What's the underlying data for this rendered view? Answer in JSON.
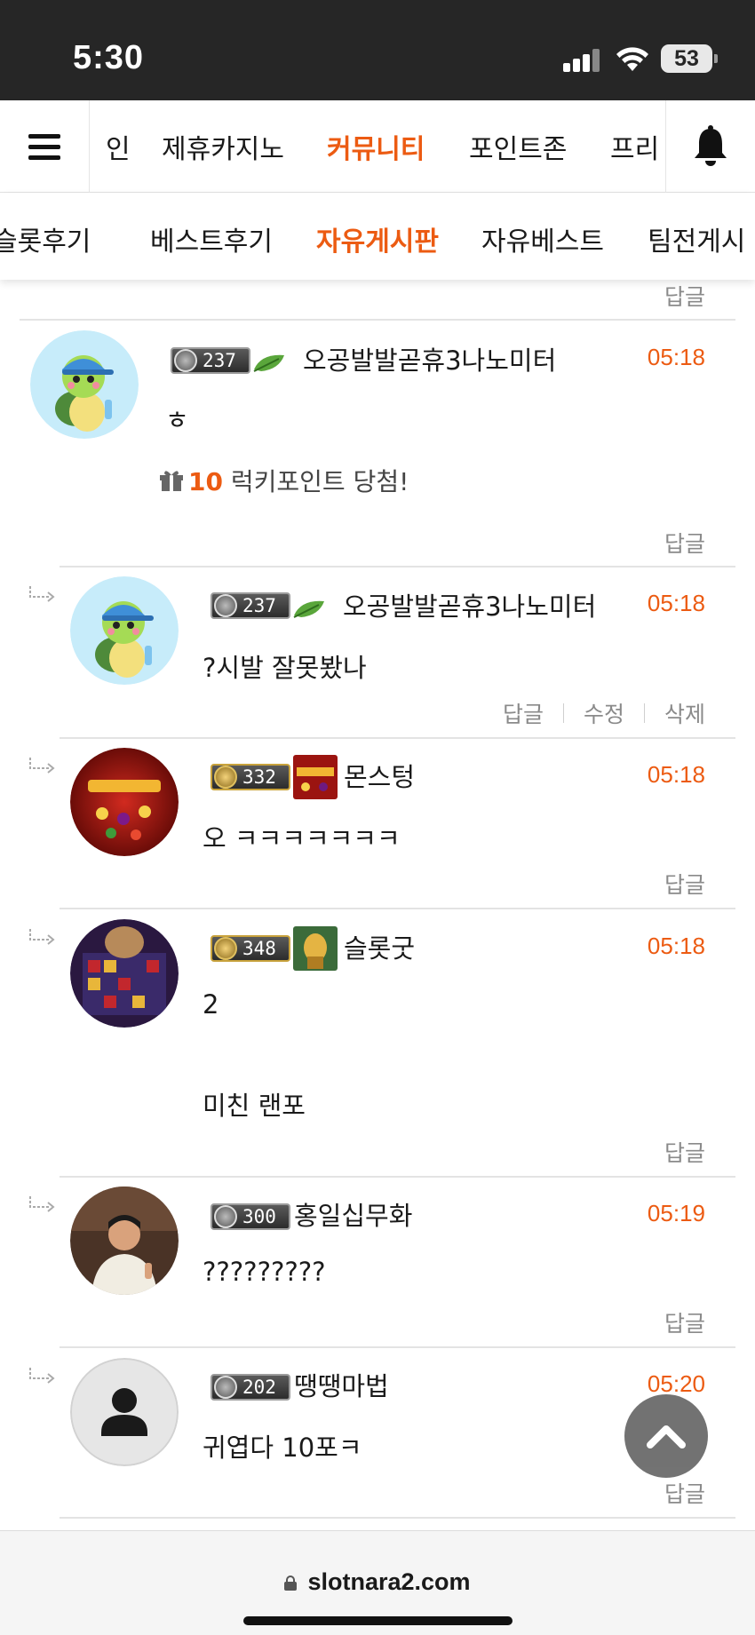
{
  "status": {
    "time": "5:30",
    "battery": "53"
  },
  "main_nav": {
    "items": [
      {
        "label": "인"
      },
      {
        "label": "제휴카지노"
      },
      {
        "label": "커뮤니티"
      },
      {
        "label": "포인트존"
      },
      {
        "label": "프리"
      }
    ],
    "active_color": "#ec5b12"
  },
  "sub_nav": {
    "items": [
      {
        "label": "슬롯후기"
      },
      {
        "label": "베스트후기"
      },
      {
        "label": "자유게시판"
      },
      {
        "label": "자유베스트"
      },
      {
        "label": "팀전게시"
      }
    ]
  },
  "top_reply_label": "답글",
  "comments": [
    {
      "level": "237",
      "username": "오공발발곧휴3나노미터",
      "time": "05:18",
      "text": "ㅎ",
      "lucky_points": "10",
      "lucky_text": "럭키포인트 당첨!",
      "reply_label": "답글"
    },
    {
      "level": "237",
      "username": "오공발발곧휴3나노미터",
      "time": "05:18",
      "text": "?시발 잘못봤나",
      "reply_label": "답글",
      "edit_label": "수정",
      "delete_label": "삭제"
    },
    {
      "level": "332",
      "username": "몬스텅",
      "time": "05:18",
      "text": "오 ㅋㅋㅋㅋㅋㅋㅋ",
      "reply_label": "답글"
    },
    {
      "level": "348",
      "username": "슬롯굿",
      "time": "05:18",
      "text_line1": "2",
      "text_line2": "미친 랜포",
      "reply_label": "답글"
    },
    {
      "level": "300",
      "username": "홍일십무화",
      "time": "05:19",
      "text": "?????????",
      "reply_label": "답글"
    },
    {
      "level": "202",
      "username": "땡땡마법",
      "time": "05:20",
      "text": "귀엽다 10포ㅋ",
      "reply_label": "답글"
    }
  ],
  "browser": {
    "url": "slotnara2.com"
  }
}
